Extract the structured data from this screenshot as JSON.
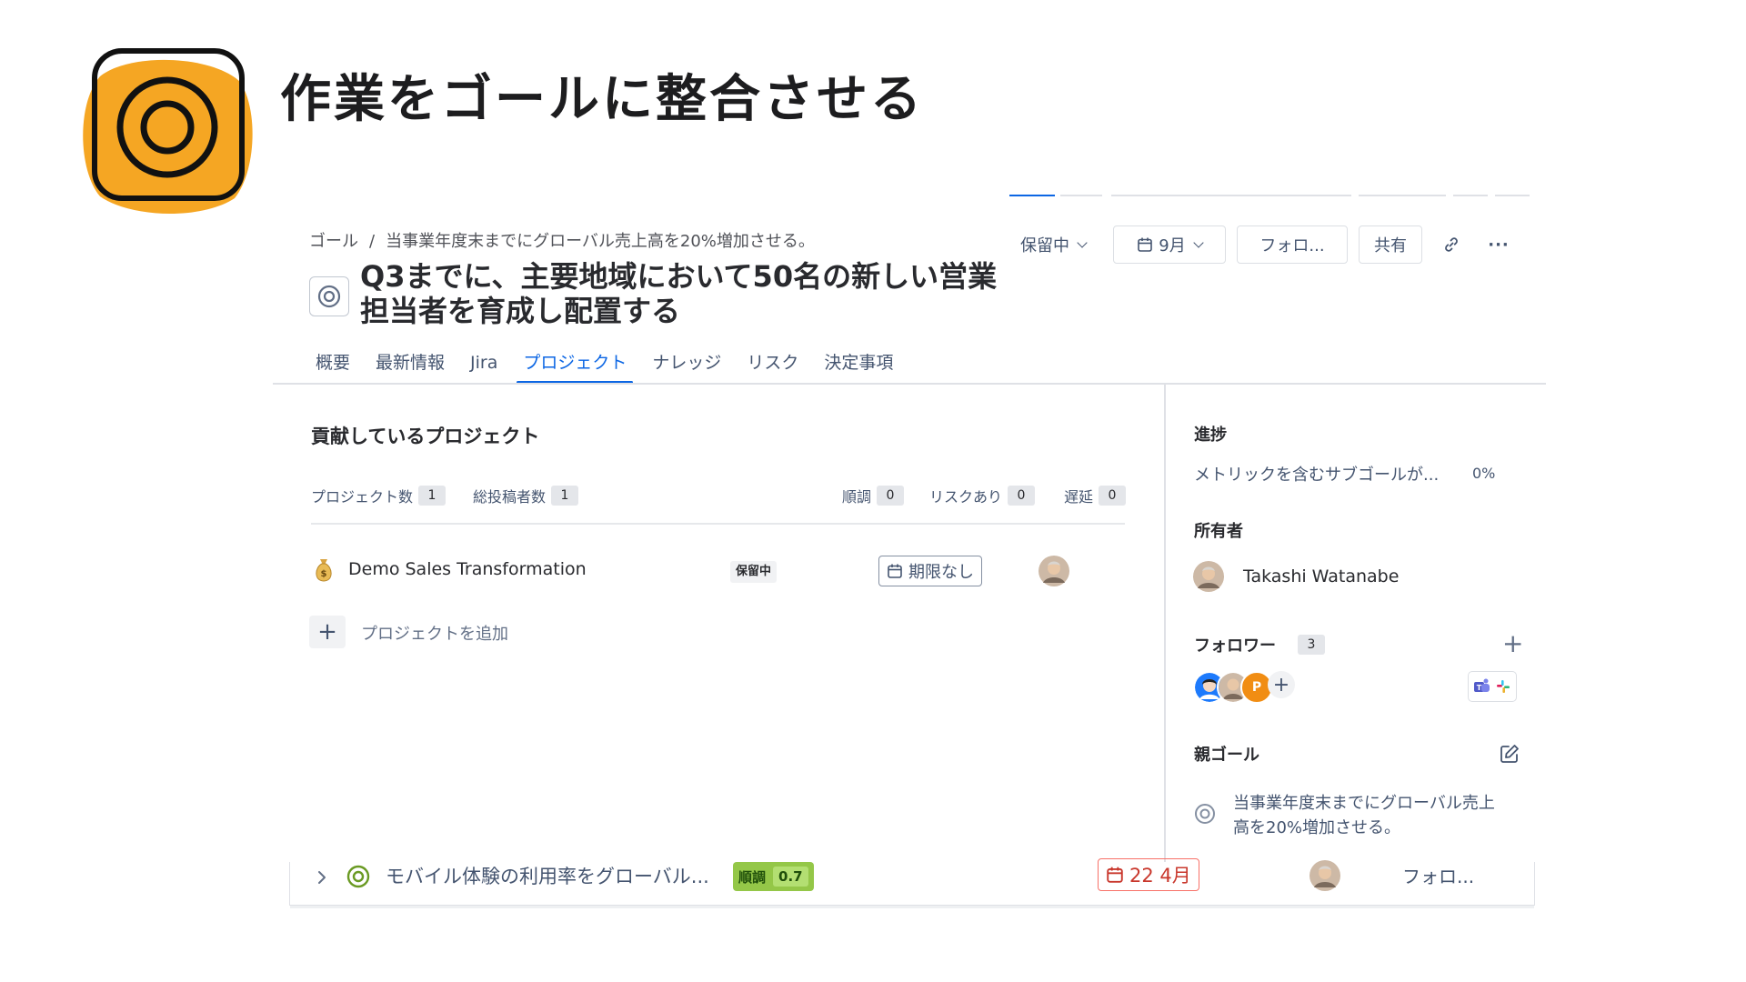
{
  "hero": {
    "title": "作業をゴールに整合させる"
  },
  "breadcrumb": {
    "root": "ゴール",
    "separator": "/",
    "parent": "当事業年度末までにグローバル売上高を20%増加させる。"
  },
  "goal": {
    "title": "Q3までに、主要地域において50名の新しい営業担当者を育成し配置する"
  },
  "header": {
    "status_label": "保留中",
    "date_label": "9月",
    "follow_label": "フォロ...",
    "share_label": "共有",
    "more_label": "···"
  },
  "tabs": [
    {
      "label": "概要"
    },
    {
      "label": "最新情報"
    },
    {
      "label": "Jira"
    },
    {
      "label": "プロジェクト",
      "active": true
    },
    {
      "label": "ナレッジ"
    },
    {
      "label": "リスク"
    },
    {
      "label": "決定事項"
    }
  ],
  "projects": {
    "heading": "貢献しているプロジェクト",
    "stats": {
      "project_count_label": "プロジェクト数",
      "project_count": "1",
      "contributors_label": "総投稿者数",
      "contributors": "1",
      "on_track_label": "順調",
      "on_track": "0",
      "at_risk_label": "リスクあり",
      "at_risk": "0",
      "delayed_label": "遅延",
      "delayed": "0"
    },
    "items": [
      {
        "icon": "money-bag-icon",
        "name": "Demo Sales Transformation",
        "status": "保留中",
        "due": "期限なし"
      }
    ],
    "add_label": "プロジェクトを追加"
  },
  "side": {
    "progress_label": "進捗",
    "progress_text": "メトリックを含むサブゴールが...",
    "progress_value": "0%",
    "owner_label": "所有者",
    "owner_name": "Takashi Watanabe",
    "followers_label": "フォロワー",
    "followers_count": "3",
    "follower_initial": "P",
    "parent_goal_label": "親ゴール",
    "parent_goal_text": "当事業年度末までにグローバル売上高を20%増加させる。"
  },
  "bottom_row": {
    "title": "モバイル体験の利用率をグローバル...",
    "status": "順調",
    "score": "0.7",
    "due": "22 4月",
    "follow_label": "フォロ..."
  },
  "colors": {
    "accent": "#0c66e4",
    "logo_orange": "#f5a623",
    "on_track_green": "#94c748",
    "overdue_red": "#c9372c"
  }
}
